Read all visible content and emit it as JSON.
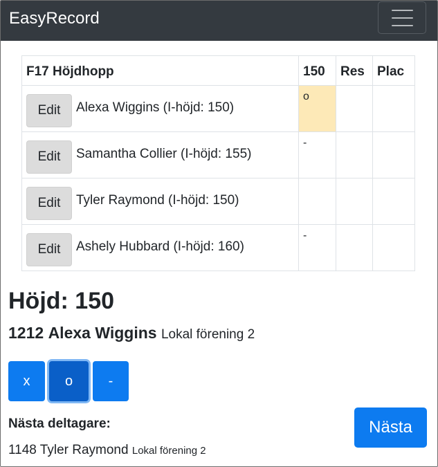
{
  "app": {
    "brand": "EasyRecord"
  },
  "table": {
    "header": {
      "event": "F17 Höjdhopp",
      "height_col": "150",
      "res": "Res",
      "plac": "Plac"
    },
    "rows": [
      {
        "edit_label": "Edit",
        "name": "Alexa Wiggins (I-höjd: 150)",
        "h150": "o",
        "res": "",
        "plac": ""
      },
      {
        "edit_label": "Edit",
        "name": "Samantha Collier (I-höjd: 155)",
        "h150": "-",
        "res": "",
        "plac": ""
      },
      {
        "edit_label": "Edit",
        "name": "Tyler Raymond (I-höjd: 150)",
        "h150": "",
        "res": "",
        "plac": ""
      },
      {
        "edit_label": "Edit",
        "name": "Ashely Hubbard (I-höjd: 160)",
        "h150": "-",
        "res": "",
        "plac": ""
      }
    ]
  },
  "current": {
    "height_title": "Höjd: 150",
    "number": "1212",
    "name": "Alexa Wiggins",
    "club": "Lokal förening 2"
  },
  "attempt_buttons": {
    "x": "x",
    "o": "o",
    "dash": "-"
  },
  "next": {
    "label": "Nästa deltagare:",
    "number": "1148",
    "name": "Tyler Raymond",
    "club": "Lokal förening 2",
    "button_label": "Nästa"
  },
  "colors": {
    "navbar": "#343a40",
    "primary": "#0d7bf0",
    "current_cell": "#fde9b7"
  }
}
